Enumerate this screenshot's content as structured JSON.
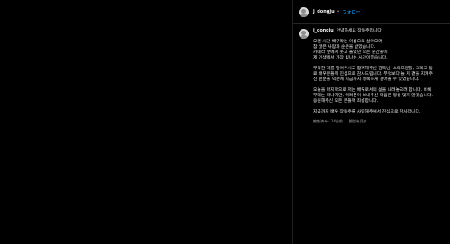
{
  "header": {
    "username": "j_dongju",
    "separator": "•",
    "follow_label": "フォロー"
  },
  "caption": {
    "username": "j_dongju",
    "intro": "안녕하세요 장동주입니다.",
    "paragraphs": [
      [
        "오랜 시간 배우라는 이름으로 살아오며",
        "참 많은 사람과 순분을 받았습니다.",
        "카메라 앞에서 웃고 울었던 모든 순간들이",
        "제 인생에서 가장 빛나는 시간이었습니다."
      ],
      [
        "부족한 저를 믿어주시고 함께해주신 감독님, 스태프분들, 그리고 동",
        "료 배우분들께 진심으로 감사드립니다. 무엇보다 늘 제 곁을 지켜주",
        "신 팬분들 덕분에 지금까지 행복하게 걸어올 수 있었습니다."
      ],
      [
        "오늘을 마지막으로 저는 배우로서의 삶을 내려놓으려 합니다. 비록",
        "무대는 떠나지만, 여러분이 보내주신 마음은 평생 잊지 않겠습니다.",
        "응원해주신 모든 분들께 죄송합니다."
      ],
      [
        "지금까지 배우 장동주를 사랑해주셔서 진심으로 감사합니다."
      ]
    ],
    "meta": {
      "edited": "編集済み · 14分前",
      "translate": "翻訳を見る"
    }
  }
}
